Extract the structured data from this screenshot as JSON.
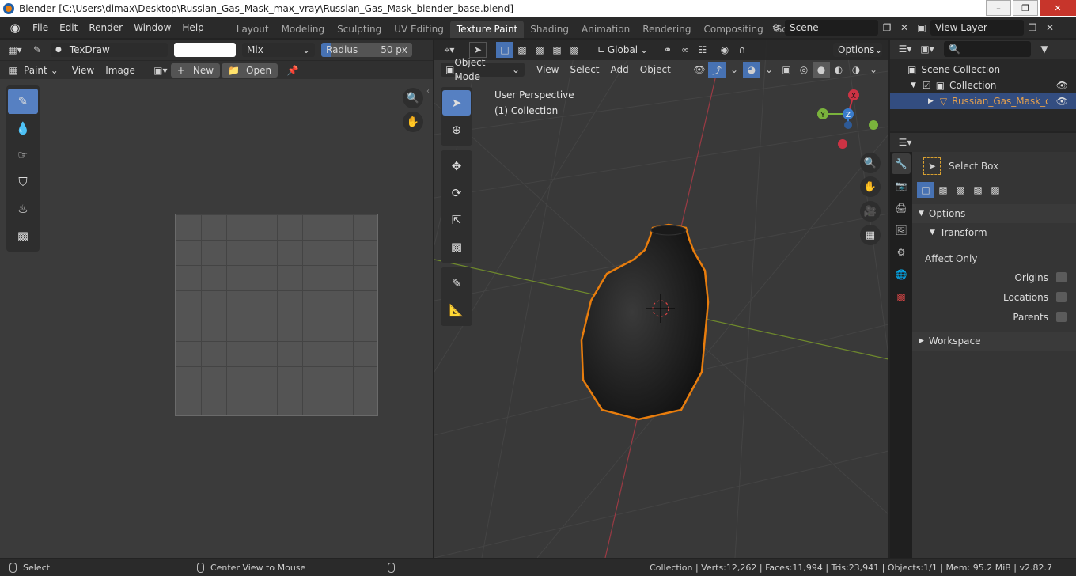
{
  "window": {
    "title": "Blender [C:\\Users\\dimax\\Desktop\\Russian_Gas_Mask_max_vray\\Russian_Gas_Mask_blender_base.blend]"
  },
  "menu": [
    "File",
    "Edit",
    "Render",
    "Window",
    "Help"
  ],
  "workspaces": [
    "Layout",
    "Modeling",
    "Sculpting",
    "UV Editing",
    "Texture Paint",
    "Shading",
    "Animation",
    "Rendering",
    "Compositing",
    "Scripting"
  ],
  "active_workspace": "Texture Paint",
  "scene": {
    "name": "Scene",
    "view_layer": "View Layer"
  },
  "image_editor": {
    "brush_name": "TexDraw",
    "blend_mode": "Mix",
    "radius_label": "Radius",
    "radius_value": "50 px",
    "mode": "Paint",
    "menus": [
      "View",
      "Image"
    ],
    "new_label": "New",
    "open_label": "Open"
  },
  "viewport": {
    "transform_orientation": "Global",
    "options_label": "Options",
    "mode": "Object Mode",
    "menus": [
      "View",
      "Select",
      "Add",
      "Object"
    ],
    "perspective": "User Perspective",
    "collection_info": "(1) Collection",
    "gizmo": {
      "x_color": "#cc3344",
      "y_color": "#7ab33c",
      "z_color": "#3a7ccc"
    }
  },
  "outliner": {
    "scene_collection": "Scene Collection",
    "collection": "Collection",
    "object": "Russian_Gas_Mask_obj_l"
  },
  "properties": {
    "tool_name": "Select Box",
    "options_label": "Options",
    "transform_label": "Transform",
    "affect_only_label": "Affect Only",
    "origins": "Origins",
    "locations": "Locations",
    "parents": "Parents",
    "workspace_label": "Workspace"
  },
  "status": {
    "select": "Select",
    "center_view": "Center View to Mouse",
    "stats": "Collection | Verts:12,262 | Faces:11,994 | Tris:23,941 | Objects:1/1 | Mem: 95.2 MiB | v2.82.7"
  },
  "colors": {
    "accent": "#4772b3",
    "selection_outline": "#e87d0d",
    "active_object_text": "#e5a04d"
  }
}
